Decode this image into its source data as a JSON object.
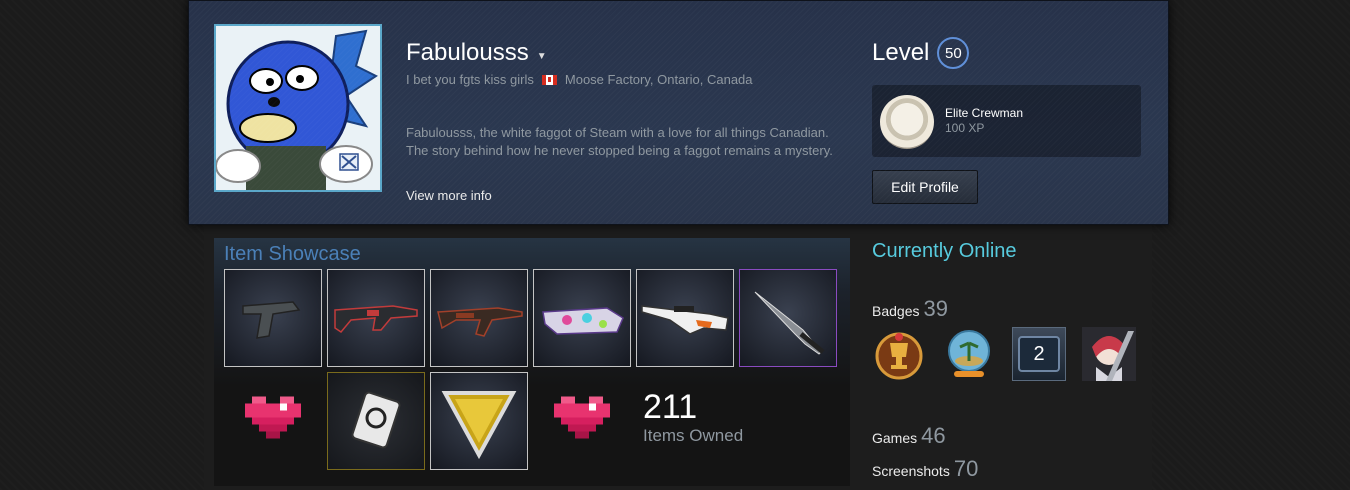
{
  "profile": {
    "name": "Fabulousss",
    "tagline": "I bet you fgts kiss girls",
    "location": "Moose Factory, Ontario, Canada",
    "summary_line1": "Fabulousss, the white faggot of Steam with a love for all things Canadian.",
    "summary_line2": "The story behind how he never stopped being a faggot remains a mystery.",
    "view_more": "View more info"
  },
  "level": {
    "label": "Level",
    "value": "50",
    "badge_name": "Elite Crewman",
    "badge_xp": "100 XP",
    "edit_button": "Edit Profile"
  },
  "showcase": {
    "title": "Item Showcase",
    "items_count": "211",
    "items_label": "Items Owned",
    "items": [
      {
        "icon": "pistol-icon"
      },
      {
        "icon": "rifle-m4-icon"
      },
      {
        "icon": "rifle-ak-icon"
      },
      {
        "icon": "smg-p90-icon"
      },
      {
        "icon": "sniper-awp-icon"
      },
      {
        "icon": "knife-icon"
      },
      {
        "icon": "pixel-heart-icon"
      },
      {
        "icon": "sticker-card-icon"
      },
      {
        "icon": "esl-pin-icon"
      },
      {
        "icon": "pixel-heart-icon"
      }
    ]
  },
  "status": {
    "online": "Currently Online"
  },
  "stats": {
    "badges_label": "Badges",
    "badges_count": "39",
    "games_label": "Games",
    "games_count": "46",
    "screenshots_label": "Screenshots",
    "screenshots_count": "70",
    "level_badge_value": "2"
  },
  "colors": {
    "accent_online": "#57cbde",
    "showcase_title": "#4b80b8",
    "knife_rarity": "#8a4bc0"
  }
}
